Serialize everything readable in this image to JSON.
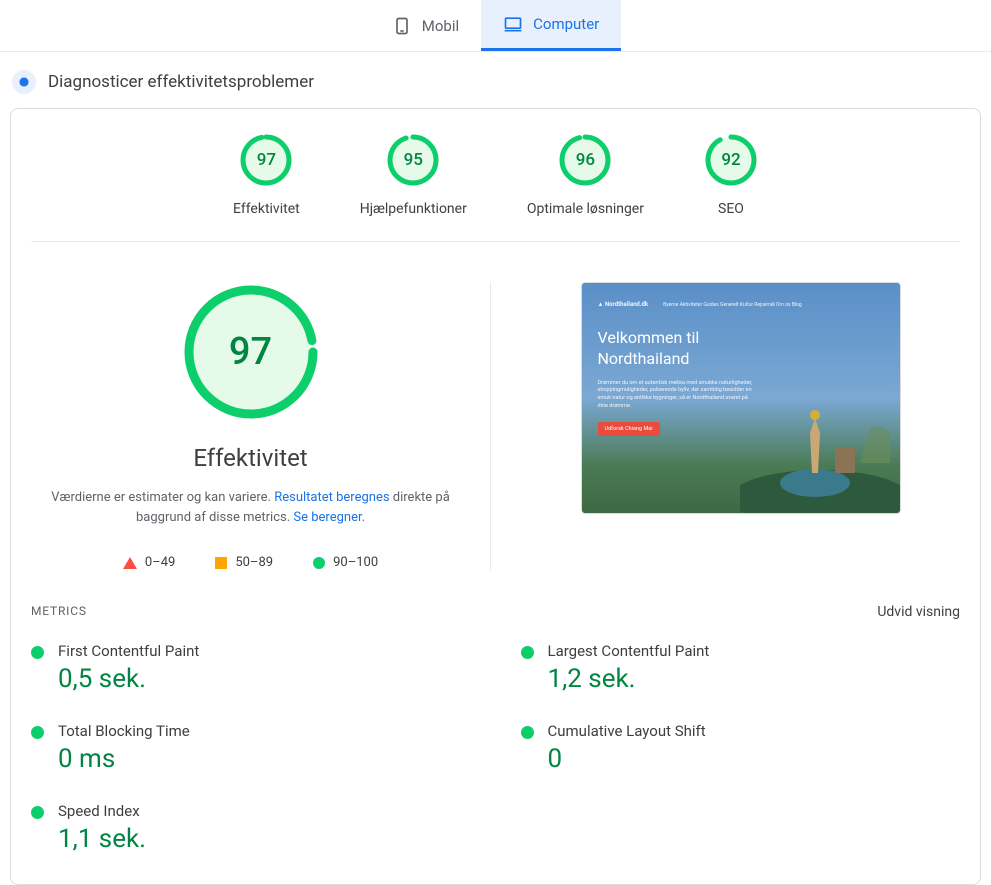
{
  "tabs": {
    "mobile": "Mobil",
    "computer": "Computer"
  },
  "diagnose_title": "Diagnosticer effektivitetsproblemer",
  "scores": [
    {
      "value": 97,
      "label": "Effektivitet"
    },
    {
      "value": 95,
      "label": "Hjælpefunktioner"
    },
    {
      "value": 96,
      "label": "Optimale løsninger"
    },
    {
      "value": 92,
      "label": "SEO"
    }
  ],
  "hero": {
    "score": 97,
    "title": "Effektivitet",
    "desc_pre": "Værdierne er estimater og kan variere. ",
    "desc_link1": "Resultatet beregnes",
    "desc_mid": " direkte på baggrund af disse metrics. ",
    "desc_link2": "Se beregner"
  },
  "legend": {
    "low": "0–49",
    "mid": "50–89",
    "high": "90–100"
  },
  "preview": {
    "logo": "Nordthailand.dk",
    "nav": [
      "Byerne",
      "Aktiviteter",
      "Guides",
      "Generelt",
      "Kultur",
      "Rejsemål",
      "Om os",
      "Blog"
    ],
    "headline1": "Velkommen til",
    "headline2": "Nordthailand",
    "body": "Drømmer du om et autentisk mekka med smukke naturligheder, shoppingmuligheder, pulserende byliv, der samtidig besidder en smuk natur og antikke bygninger, så er Nordthailand svaret på dine drømme.",
    "button": "Udforsk Chiang Mai"
  },
  "metrics_header": "METRICS",
  "expand": "Udvid visning",
  "metrics": [
    {
      "name": "First Contentful Paint",
      "value": "0,5 sek."
    },
    {
      "name": "Largest Contentful Paint",
      "value": "1,2 sek."
    },
    {
      "name": "Total Blocking Time",
      "value": "0 ms"
    },
    {
      "name": "Cumulative Layout Shift",
      "value": "0"
    },
    {
      "name": "Speed Index",
      "value": "1,1 sek."
    }
  ]
}
